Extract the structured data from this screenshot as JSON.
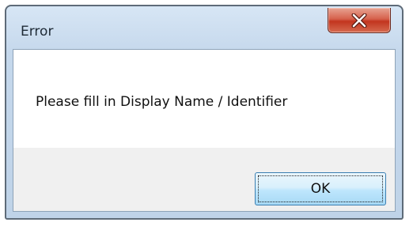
{
  "dialog": {
    "title": "Error",
    "message": "Please fill in Display Name / Identifier",
    "ok_label": "OK",
    "close_icon": "close-x-icon"
  },
  "colors": {
    "close_button": "#c7432c",
    "frame": "#bfd3e8",
    "ok_border": "#3c7fb1"
  }
}
